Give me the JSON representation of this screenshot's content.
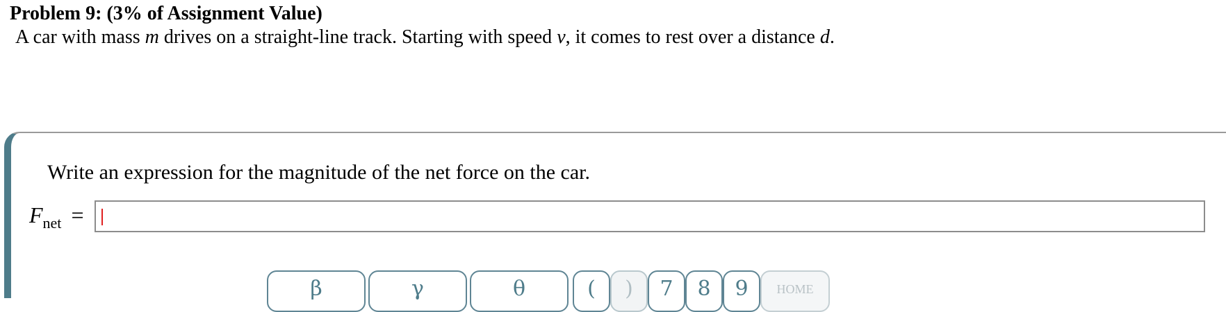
{
  "problem": {
    "title": "Problem 9: (3% of Assignment Value)",
    "statement_parts": {
      "p1": "A car with mass ",
      "m": "m",
      "p2": " drives on a straight-line track. Starting with speed ",
      "v": "v",
      "p3": ", it comes to rest over a distance ",
      "d": "d",
      "p4": "."
    }
  },
  "question": {
    "prompt": "Write an expression for the magnitude of the net force on the car.",
    "answer_var": "F",
    "answer_sub": "net",
    "equals": "=",
    "answer_value": ""
  },
  "keypad": {
    "keys": [
      "β",
      "γ",
      "θ",
      "(",
      ")",
      "7",
      "8",
      "9",
      "HOME"
    ]
  },
  "colors": {
    "accent": "#4e7c8a",
    "caret": "#e02020"
  }
}
